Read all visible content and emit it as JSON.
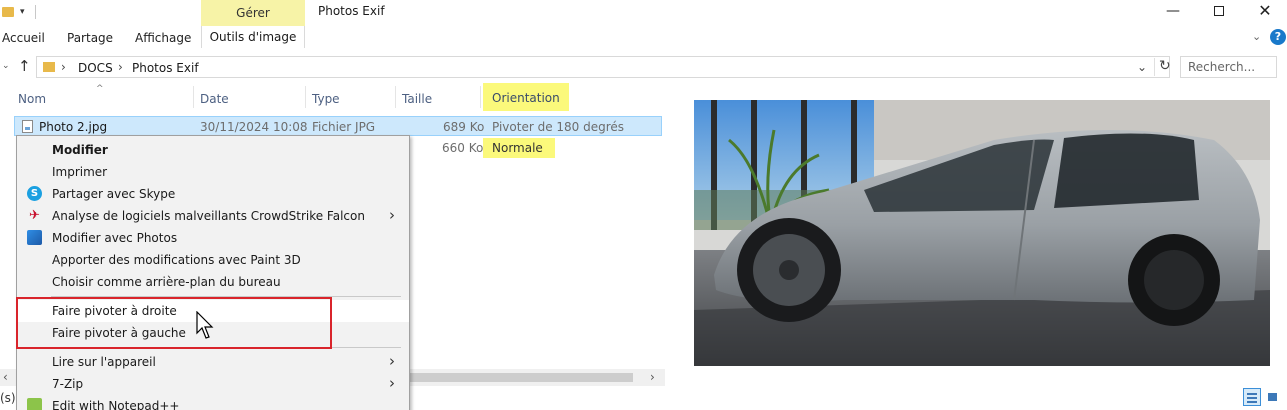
{
  "window": {
    "title": "Photos Exif",
    "contextual_group": "Gérer",
    "min_glyph": "—",
    "close_glyph": "✕"
  },
  "ribbon": {
    "tabs": [
      "Accueil",
      "Partage",
      "Affichage"
    ],
    "contextual_tab": "Outils d'image",
    "help_glyph": "?"
  },
  "address": {
    "crumbs": [
      "DOCS",
      "Photos Exif"
    ],
    "search_placeholder": "Recherch..."
  },
  "columns": {
    "name": "Nom",
    "date": "Date",
    "type": "Type",
    "size": "Taille",
    "orientation": "Orientation"
  },
  "files": [
    {
      "name": "Photo 2.jpg",
      "date": "30/11/2024 10:08",
      "type": "Fichier JPG",
      "size": "689 Ko",
      "orientation": "Pivoter de 180 degrés"
    },
    {
      "size": "660 Ko",
      "orientation": "Normale"
    }
  ],
  "context_menu": {
    "items": [
      {
        "label": "Modifier",
        "bold": true
      },
      {
        "label": "Imprimer"
      },
      {
        "label": "Partager avec Skype",
        "icon": "skype-icon"
      },
      {
        "label": "Analyse de logiciels malveillants CrowdStrike Falcon",
        "icon": "crowdstrike-icon",
        "submenu": true
      },
      {
        "label": "Modifier avec Photos",
        "icon": "photos-icon"
      },
      {
        "label": "Apporter des modifications avec Paint 3D"
      },
      {
        "label": "Choisir comme arrière-plan du bureau"
      },
      {
        "label": "Faire pivoter à droite"
      },
      {
        "label": "Faire pivoter à gauche"
      },
      {
        "label": "Lire sur l'appareil",
        "submenu": true
      },
      {
        "label": "7-Zip",
        "submenu": true
      },
      {
        "label": "Edit with Notepad++",
        "icon": "notepad-plus-plus-icon"
      }
    ]
  },
  "status": {
    "left_text": "(s)"
  },
  "colors": {
    "highlight_yellow": "#fbf97b",
    "selection_blue": "#cde8fc",
    "annotation_red": "#d9242b",
    "contextual_tab_yellow": "#f7f3a7"
  }
}
